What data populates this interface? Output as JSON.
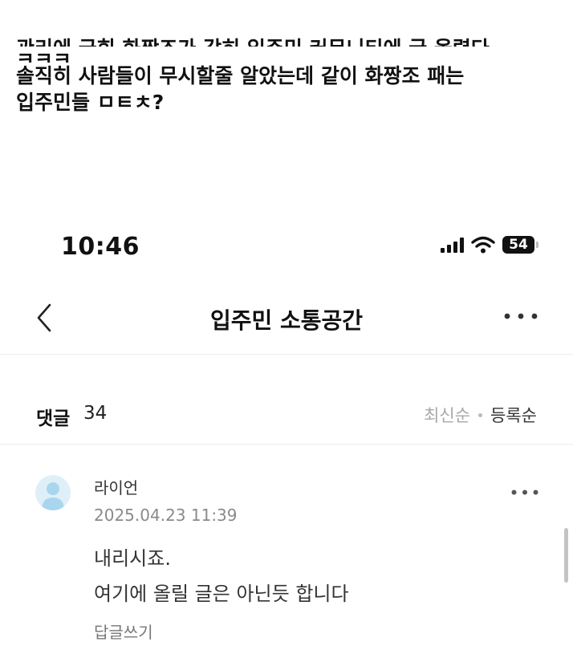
{
  "caption": {
    "lines": [
      "관리에 긁힌 화짱조가 감히 입주민 커뮤니티에 글 올렸다",
      "ㅋㅋㅋ",
      "솔직히 사람들이 무시할줄 알았는데 같이 화짱조 패는",
      "입주민들 ㅁㅌㅊ?"
    ]
  },
  "status_bar": {
    "time": "10:46",
    "battery": "54"
  },
  "nav": {
    "title": "입주민 소통공간"
  },
  "comments": {
    "label": "댓글",
    "count": "34",
    "sort_latest": "최신순",
    "sort_registered": "등록순"
  },
  "comment": {
    "author": "라이언",
    "date": "2025.04.23 11:39",
    "body_line1": "내리시죠.",
    "body_line2": "여기에 올릴 글은 아닌듯 합니다",
    "reply": "답글쓰기"
  },
  "colors": {
    "text_primary": "#111111",
    "text_secondary": "#8a8a8a",
    "avatar_bg": "#dfeff8",
    "avatar_fg": "#a9d5ee"
  }
}
